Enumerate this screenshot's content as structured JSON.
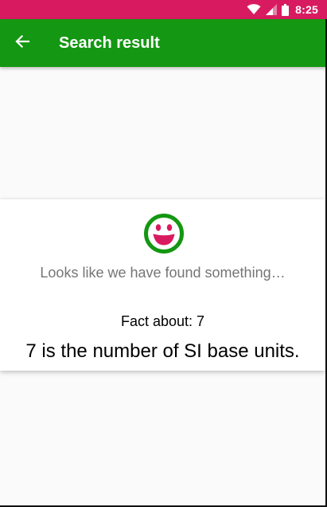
{
  "status_bar": {
    "time": "8:25",
    "color": "#d81b60",
    "icons": [
      "wifi-icon",
      "signal-icon",
      "battery-icon"
    ]
  },
  "app_bar": {
    "title": "Search result",
    "color": "#149712",
    "back_icon": "arrow-left-icon"
  },
  "result": {
    "icon": "smiley-face-icon",
    "icon_colors": {
      "ring": "#149712",
      "face": "#d81b60"
    },
    "status_text": "Looks like we have found something…",
    "fact_label": "Fact about: 7",
    "fact_text": "7 is the number of SI base units."
  }
}
